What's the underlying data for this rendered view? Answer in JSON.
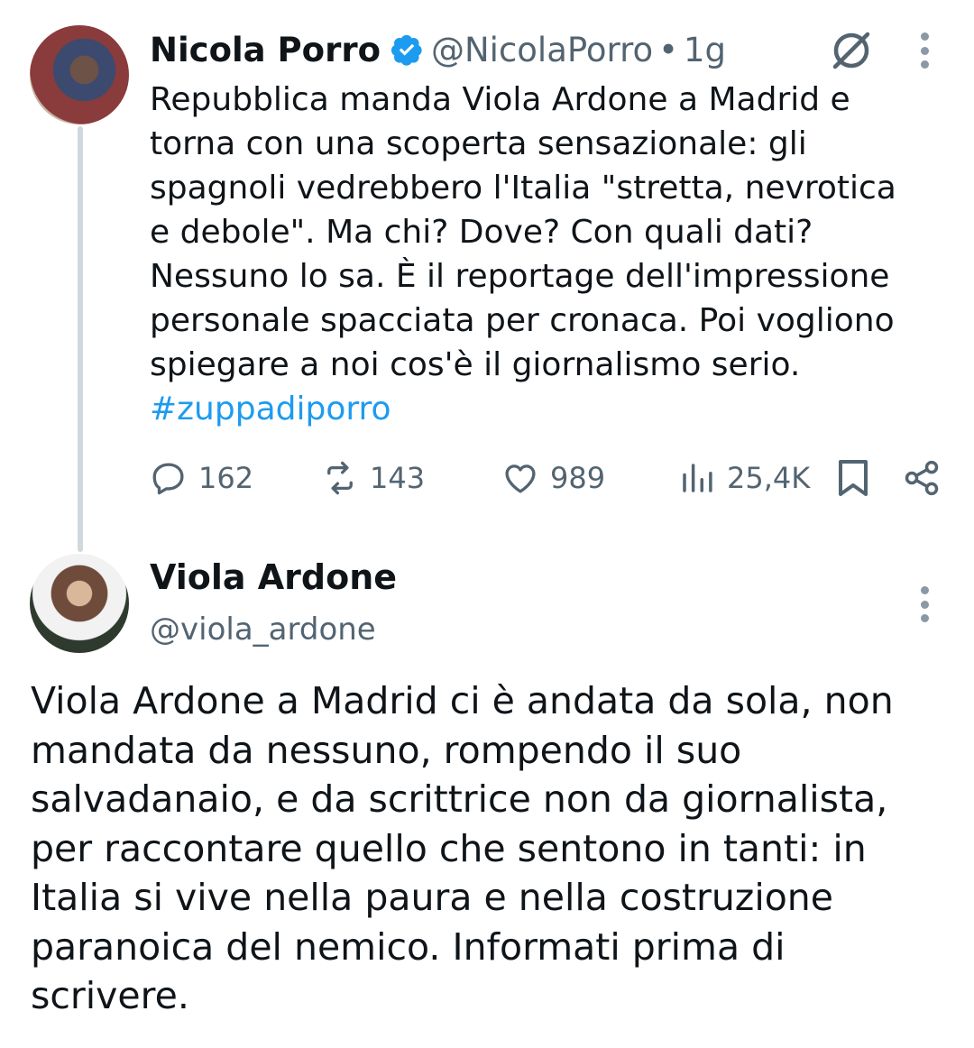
{
  "tweet1": {
    "display_name": "Nicola Porro",
    "handle": "@NicolaPorro",
    "separator": "•",
    "time": "1g",
    "text": "Repubblica manda Viola Ardone a Madrid e\ntorna con una scoperta sensazionale: gli\nspagnoli vedrebbero l'Italia \"stretta, nevrotica\ne debole\". Ma chi? Dove? Con quali dati?\nNessuno lo sa. È il reportage dell'impressione\npersonale spacciata per cronaca. Poi vogliono\nspiegare a noi cos'è il giornalismo serio.",
    "hashtag": "#zuppadiporro",
    "stats": {
      "replies": "162",
      "retweets": "143",
      "likes": "989",
      "views": "25,4K"
    }
  },
  "tweet2": {
    "display_name": "Viola Ardone",
    "handle": "@viola_ardone",
    "text": "Viola Ardone a Madrid ci è andata da sola, non\nmandata da nessuno, rompendo il suo\nsalvadanaio, e da scrittrice  non da giornalista,\nper raccontare quello che sentono in tanti: in\nItalia si vive nella paura e nella costruzione\nparanoica del nemico. Informati prima di\nscrivere."
  },
  "colors": {
    "text": "#0f1419",
    "secondary": "#536471",
    "link": "#1d9bf0",
    "verified": "#1d9bf0",
    "thread_line": "#cfd9de"
  },
  "icons": {
    "verified": "verified-badge-icon",
    "grok": "grok-icon",
    "more": "more-dots-icon",
    "reply": "reply-icon",
    "retweet": "retweet-icon",
    "like": "heart-icon",
    "views": "views-chart-icon",
    "bookmark": "bookmark-icon",
    "share": "share-icon"
  }
}
